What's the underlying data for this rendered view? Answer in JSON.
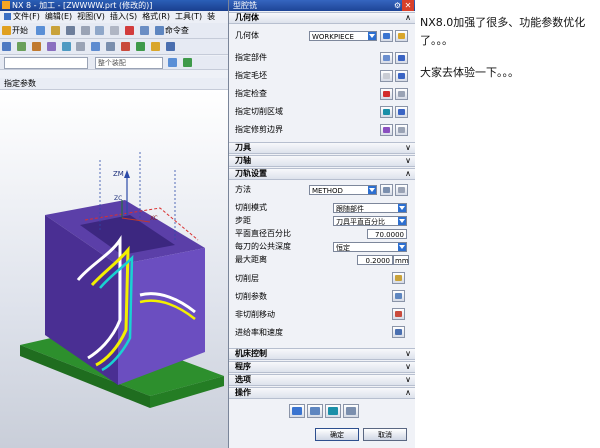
{
  "window": {
    "title": "NX 8 - 加工 - [ZWWWW.prt (修改的)]"
  },
  "menubar": {
    "items": [
      "文件(F)",
      "编辑(E)",
      "视图(V)",
      "插入(S)",
      "格式(R)",
      "工具(T)",
      "装"
    ]
  },
  "toolbar": {
    "start_label": "开始",
    "command_finder_label": "命令查",
    "filter_combo": "",
    "assembly_combo": "整个装配"
  },
  "navigator": {
    "header": "指定参数"
  },
  "viewport": {
    "axis_zm": "ZM",
    "axis_zc": "ZC",
    "axis_xc": "XC"
  },
  "dialog": {
    "title": "型腔铣",
    "sections": {
      "geometry": "几何体",
      "tool": "刀具",
      "tool_axis": "刀轴",
      "path_settings": "刀轨设置",
      "machine_control": "机床控制",
      "program": "程序",
      "options": "选项",
      "actions": "操作"
    },
    "geometry": {
      "geometry_label": "几何体",
      "geometry_value": "WORKPIECE",
      "part_label": "指定部件",
      "blank_label": "指定毛坯",
      "check_label": "指定检查",
      "cut_area_label": "指定切削区域",
      "trim_label": "指定修剪边界"
    },
    "path": {
      "method_label": "方法",
      "method_value": "METHOD",
      "cut_pattern_label": "切削模式",
      "cut_pattern_value": "跟随部件",
      "stepover_label": "步距",
      "stepover_value": "刀具平直百分比",
      "flat_diameter_label": "平面直径百分比",
      "flat_diameter_value": "70.0000",
      "common_depth_label": "每刀的公共深度",
      "common_depth_value": "恒定",
      "max_distance_label": "最大距离",
      "max_distance_value": "0.2000",
      "max_distance_unit": "mm",
      "cut_levels_label": "切削层",
      "cut_params_label": "切削参数",
      "non_cut_label": "非切削移动",
      "feeds_label": "进给率和速度"
    },
    "buttons": {
      "ok": "确定",
      "cancel": "取消"
    },
    "colors": {
      "accent": "#2d6fd0",
      "title_bar": "#1e4596"
    }
  },
  "post": {
    "line1": "NX8.0加强了很多、功能参数优化了。。。",
    "line2": "大家去体验一下。。。"
  }
}
